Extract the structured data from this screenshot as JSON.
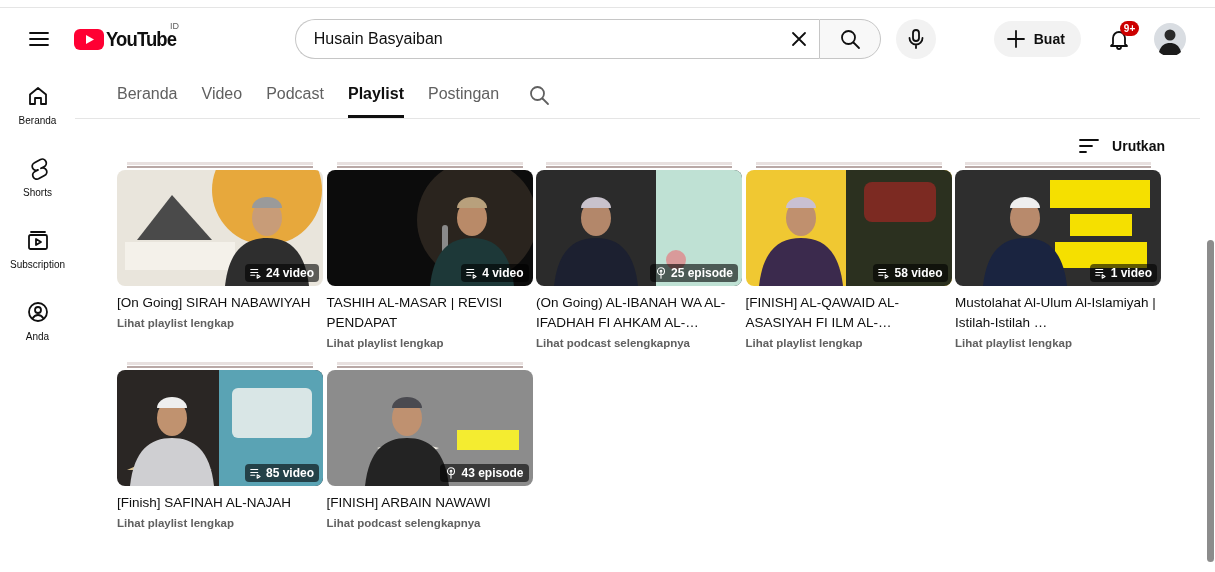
{
  "header": {
    "logo": "YouTube",
    "country_code": "ID",
    "search": {
      "value": "Husain Basyaiban"
    },
    "create_button": "Buat",
    "notification_badge": "9+"
  },
  "sidebar": {
    "items": [
      {
        "label": "Beranda",
        "kind": "home"
      },
      {
        "label": "Shorts",
        "kind": "shorts"
      },
      {
        "label": "Subscription",
        "kind": "subscriptions"
      },
      {
        "label": "Anda",
        "kind": "you"
      }
    ]
  },
  "tabs": [
    {
      "label": "Beranda",
      "selected": false
    },
    {
      "label": "Video",
      "selected": false
    },
    {
      "label": "Podcast",
      "selected": false
    },
    {
      "label": "Playlist",
      "selected": true
    },
    {
      "label": "Postingan",
      "selected": false
    }
  ],
  "sort_button": "Urutkan",
  "playlists": [
    {
      "title": "[On Going] SIRAH NABAWIYAH",
      "link": "Lihat playlist lengkap",
      "count": "24 video",
      "kind": "playlist"
    },
    {
      "title": "TASHIH AL-MASAR | REVISI PENDAPAT",
      "link": "Lihat playlist lengkap",
      "count": "4 video",
      "kind": "playlist"
    },
    {
      "title": "(On Going) AL-IBANAH WA AL-IFADHAH FI AHKAM AL-…",
      "link": "Lihat podcast selengkapnya",
      "count": "25 episode",
      "kind": "podcast"
    },
    {
      "title": "[FINISH] AL-QAWAID AL-ASASIYAH FI ILM AL-…",
      "link": "Lihat playlist lengkap",
      "count": "58 video",
      "kind": "playlist"
    },
    {
      "title": "Mustolahat Al-Ulum Al-Islamiyah | Istilah-Istilah …",
      "link": "Lihat playlist lengkap",
      "count": "1 video",
      "kind": "playlist"
    },
    {
      "title": "[Finish] SAFINAH AL-NAJAH",
      "link": "Lihat playlist lengkap",
      "count": "85 video",
      "kind": "playlist"
    },
    {
      "title": "[FINISH] ARBAIN NAWAWI",
      "link": "Lihat podcast selengkapnya",
      "count": "43 episode",
      "kind": "podcast"
    }
  ]
}
